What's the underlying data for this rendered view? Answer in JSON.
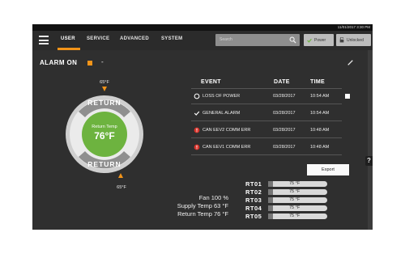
{
  "status_bar": {
    "datetime": "11/01/2017 3:30 PM"
  },
  "nav": {
    "tabs": [
      {
        "label": "USER",
        "active": true
      },
      {
        "label": "SERVICE",
        "active": false
      },
      {
        "label": "ADVANCED",
        "active": false
      },
      {
        "label": "SYSTEM",
        "active": false
      }
    ],
    "search_placeholder": "Search",
    "power_label": "Power",
    "unlocked_label": "Unlocked"
  },
  "alarm": {
    "title": "ALARM ON",
    "dash": "-"
  },
  "dial": {
    "top_setpoint": "65°F",
    "bottom_setpoint": "65°F",
    "ring_top_label": "RETURN",
    "ring_bottom_label": "RETURN",
    "center_label": "Return Temp",
    "center_value": "76°F"
  },
  "stats": {
    "fan": "Fan 100 %",
    "supply": "Supply Temp 63 °F",
    "return": "Return Temp 76 °F"
  },
  "events": {
    "headers": {
      "event": "EVENT",
      "date": "DATE",
      "time": "TIME"
    },
    "rows": [
      {
        "icon": "circle-outline-icon",
        "name": "LOSS OF POWER",
        "date": "03/28/2017",
        "time": "10:54 AM"
      },
      {
        "icon": "checkmark-icon",
        "name": "GENERAL ALARM",
        "date": "03/28/2017",
        "time": "10:54 AM"
      },
      {
        "icon": "alert-icon",
        "name": "CAN EEV2 COMM ERR",
        "date": "03/28/2017",
        "time": "10:48 AM"
      },
      {
        "icon": "alert-icon",
        "name": "CAN EEV1 COMM ERR",
        "date": "03/28/2017",
        "time": "10:48 AM"
      }
    ],
    "export_label": "Export"
  },
  "rt_sensors": [
    {
      "label": "RT01",
      "value": "75 °F"
    },
    {
      "label": "RT02",
      "value": "75 °F"
    },
    {
      "label": "RT03",
      "value": "75 °F"
    },
    {
      "label": "RT04",
      "value": "75 °F"
    },
    {
      "label": "RT05",
      "value": "75 °F"
    }
  ],
  "help_label": "?",
  "colors": {
    "accent_orange": "#f29419",
    "dial_green": "#6db33f",
    "alert_red": "#d9332b",
    "panel_bg": "#2f2f2f"
  }
}
